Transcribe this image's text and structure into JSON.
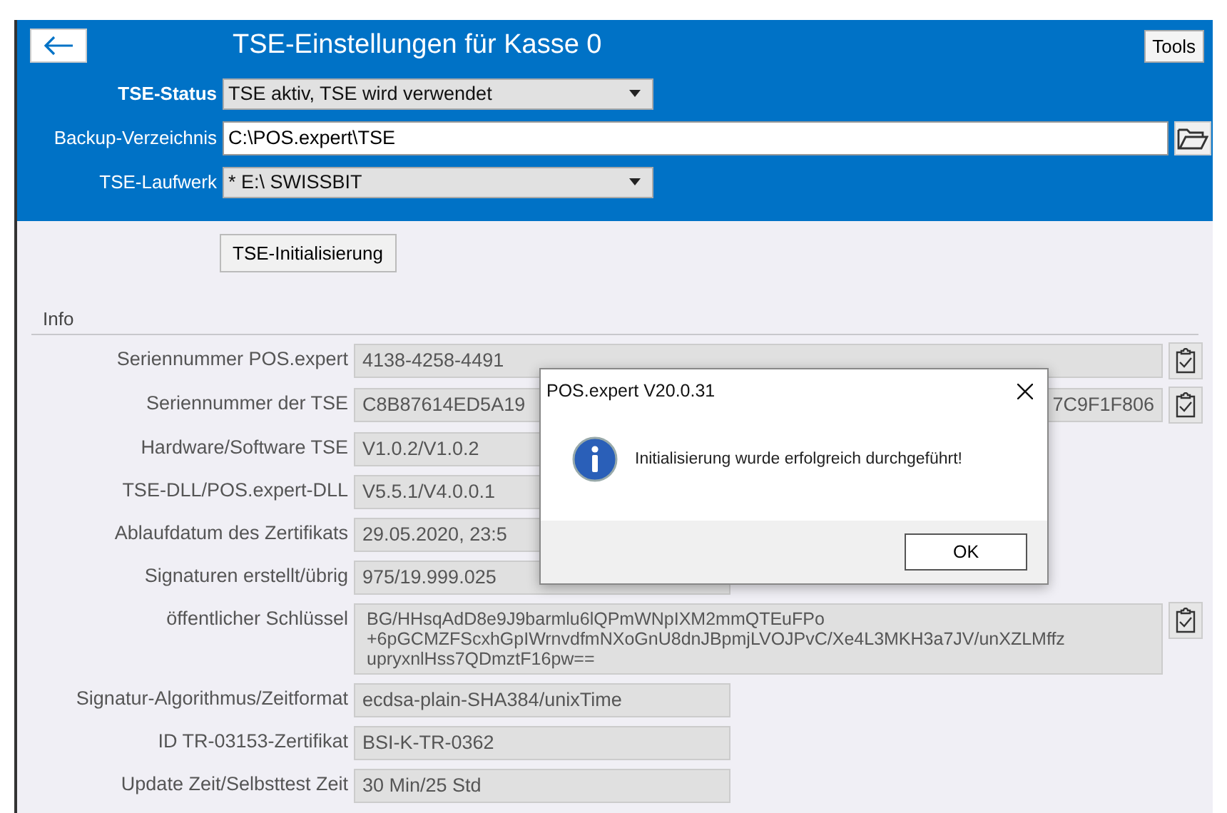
{
  "header": {
    "title": "TSE-Einstellungen für Kasse 0",
    "tools_button": "Tools"
  },
  "settings": [
    {
      "kind": "dropdown",
      "label": "TSE-Status",
      "bold": true,
      "value": "TSE aktiv, TSE wird verwendet"
    },
    {
      "kind": "path",
      "label": "Backup-Verzeichnis",
      "bold": false,
      "value": "C:\\POS.expert\\TSE"
    },
    {
      "kind": "dropdown",
      "label": "TSE-Laufwerk",
      "bold": false,
      "value": "* E:\\ SWISSBIT"
    }
  ],
  "init_button": "TSE-Initialisierung",
  "info": {
    "title": "Info",
    "rows": [
      {
        "kind": "text",
        "label": "Seriennummer POS.expert",
        "value": "4138-4258-4491",
        "wide": true,
        "copy": true
      },
      {
        "kind": "text",
        "label": "Seriennummer der TSE",
        "value": "C8B87614ED5A19",
        "value_end": "7C9F1F806",
        "wide": true,
        "copy": true
      },
      {
        "kind": "text",
        "label": "Hardware/Software TSE",
        "value": "V1.0.2/V1.0.2",
        "wide": false,
        "copy": false
      },
      {
        "kind": "text",
        "label": "TSE-DLL/POS.expert-DLL",
        "value": "V5.5.1/V4.0.0.1",
        "wide": false,
        "copy": false
      },
      {
        "kind": "text",
        "label": "Ablaufdatum des Zertifikats",
        "value": "29.05.2020, 23:5",
        "wide": false,
        "copy": false
      },
      {
        "kind": "text",
        "label": "Signaturen erstellt/übrig",
        "value": "975/19.999.025",
        "wide": false,
        "copy": false
      },
      {
        "kind": "multiline",
        "label": "öffentlicher Schlüssel",
        "lines": [
          "BG/HHsqAdD8e9J9barmlu6lQPmWNpIXM2mmQTEuFPo",
          "+6pGCMZFScxhGpIWrnvdfmNXoGnU8dnJBpmjLVOJPvC/Xe4L3MKH3a7JV/unXZLMffz",
          "upryxnlHss7QDmztF16pw=="
        ],
        "wide": true,
        "copy": true
      },
      {
        "kind": "text",
        "label": "Signatur-Algorithmus/Zeitformat",
        "value": "ecdsa-plain-SHA384/unixTime",
        "wide": false,
        "copy": false
      },
      {
        "kind": "text",
        "label": "ID TR-03153-Zertifikat",
        "value": "BSI-K-TR-0362",
        "wide": false,
        "copy": false
      },
      {
        "kind": "text",
        "label": "Update Zeit/Selbsttest Zeit",
        "value": "30 Min/25 Std",
        "wide": false,
        "copy": false
      }
    ]
  },
  "dialog": {
    "title": "POS.expert V20.0.31",
    "message": "Initialisierung wurde erfolgreich durchgeführt!",
    "ok_button": "OK"
  }
}
